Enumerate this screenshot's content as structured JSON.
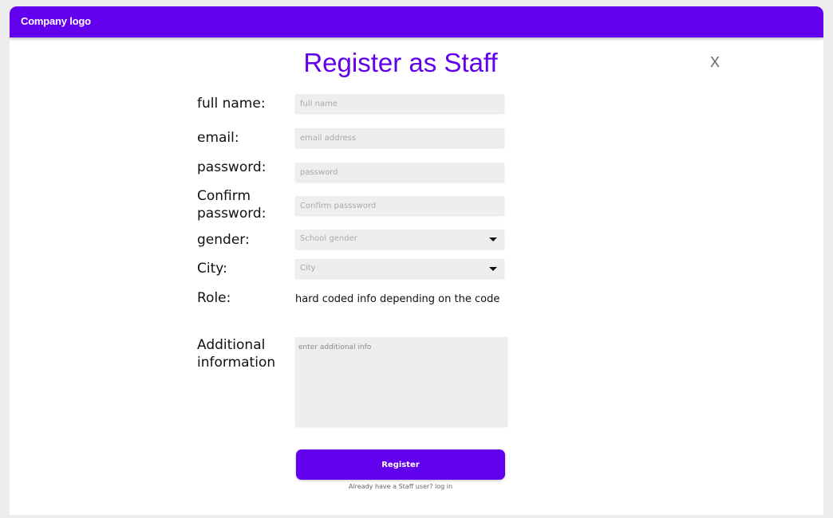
{
  "header": {
    "logo": "Company logo",
    "brand_color": "#6200ee"
  },
  "page": {
    "title": "Register as Staff",
    "close_label": "X"
  },
  "form": {
    "full_name": {
      "label": "full name:",
      "placeholder": "full name"
    },
    "email": {
      "label": "email:",
      "placeholder": "email address"
    },
    "password": {
      "label": "password:",
      "placeholder": "password"
    },
    "confirm_password": {
      "label_line1": "Confirm",
      "label_line2": "password:",
      "placeholder": "Confirm passsword"
    },
    "gender": {
      "label": "gender:",
      "placeholder": "School gender"
    },
    "city": {
      "label": "City:",
      "placeholder": "City"
    },
    "role": {
      "label": "Role:",
      "value": "hard coded info depending on the code"
    },
    "additional": {
      "label_line1": "Additional",
      "label_line2": "information",
      "placeholder": "enter additional info"
    },
    "submit_label": "Register",
    "login_link": "Already have a Staff user? log in"
  }
}
